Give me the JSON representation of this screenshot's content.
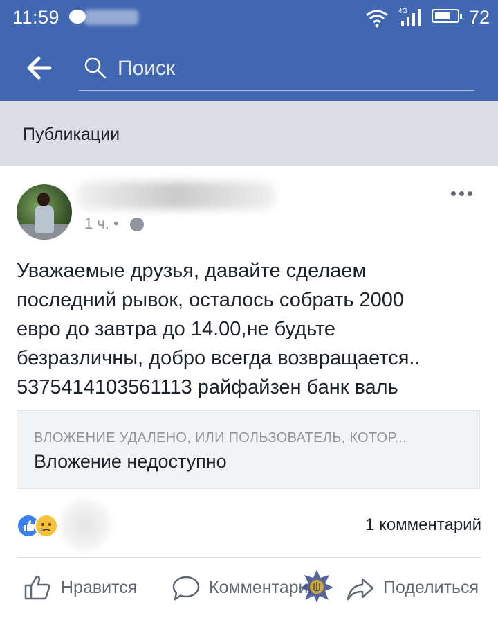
{
  "status_bar": {
    "time": "11:59",
    "network": "4G",
    "battery": "72",
    "battery_level": 0.72
  },
  "header": {
    "back_icon": "arrow-left-icon",
    "search": {
      "placeholder": "Поиск",
      "value": ""
    }
  },
  "section": {
    "title": "Публикации"
  },
  "post": {
    "time": "1 ч. •",
    "text": "Уважаемые друзья, давайте сделаем\nпоследний рывок, осталось собрать 2000\nевро до завтра до 14.00,не будьте\nбезразличны, добро всегда возвращается..\n5375414103561113 райфайзен банк валь",
    "attachment": {
      "notice": "ВЛОЖЕНИЕ УДАЛЕНО, ИЛИ ПОЛЬЗОВАТЕЛЬ, КОТОР...",
      "title": "Вложение недоступно"
    },
    "reactions": [
      "like-icon",
      "sad-icon"
    ],
    "comments": "1 комментарий"
  },
  "actions": {
    "like": "Нравится",
    "comment": "Комментарий",
    "share": "Поделиться"
  },
  "colors": {
    "brand": "#4267b2",
    "section_bg": "#dcdee3",
    "secondary_text": "#606770"
  }
}
